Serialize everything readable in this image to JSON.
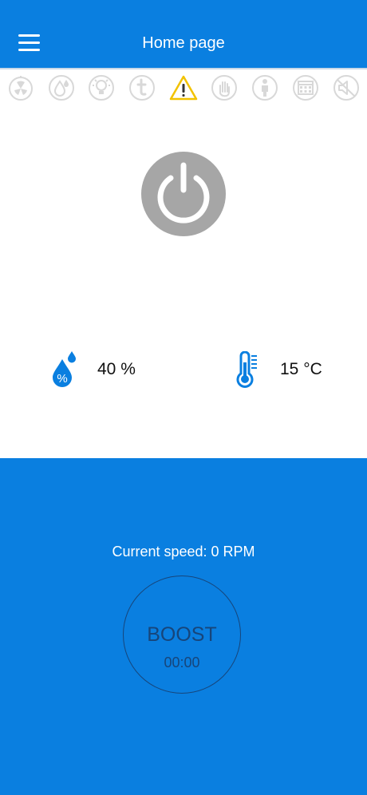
{
  "header": {
    "title": "Home page",
    "menu_icon": "hamburger-menu-icon"
  },
  "status_icons": [
    {
      "name": "timer-fan-icon",
      "active": false
    },
    {
      "name": "humidity-drop-icon",
      "active": false
    },
    {
      "name": "light-bulb-icon",
      "active": false
    },
    {
      "name": "temperature-t-icon",
      "active": false
    },
    {
      "name": "warning-icon",
      "active": true
    },
    {
      "name": "hand-icon",
      "active": false
    },
    {
      "name": "person-icon",
      "active": false
    },
    {
      "name": "calendar-icon",
      "active": false
    },
    {
      "name": "mute-icon",
      "active": false
    }
  ],
  "power": {
    "icon": "power-icon",
    "state": "off"
  },
  "humidity": {
    "value": "40 %",
    "icon": "humidity-percent-icon"
  },
  "temperature": {
    "value": "15 °C",
    "icon": "thermometer-icon"
  },
  "speed": {
    "text": "Current speed: 0 RPM"
  },
  "boost": {
    "label": "BOOST",
    "timer": "00:00"
  },
  "colors": {
    "primary": "#0A7FE0",
    "inactive_icon": "#d8d8d8",
    "warning": "#F2C200",
    "power": "#a6a6a6",
    "boost_ink": "#17457a"
  }
}
